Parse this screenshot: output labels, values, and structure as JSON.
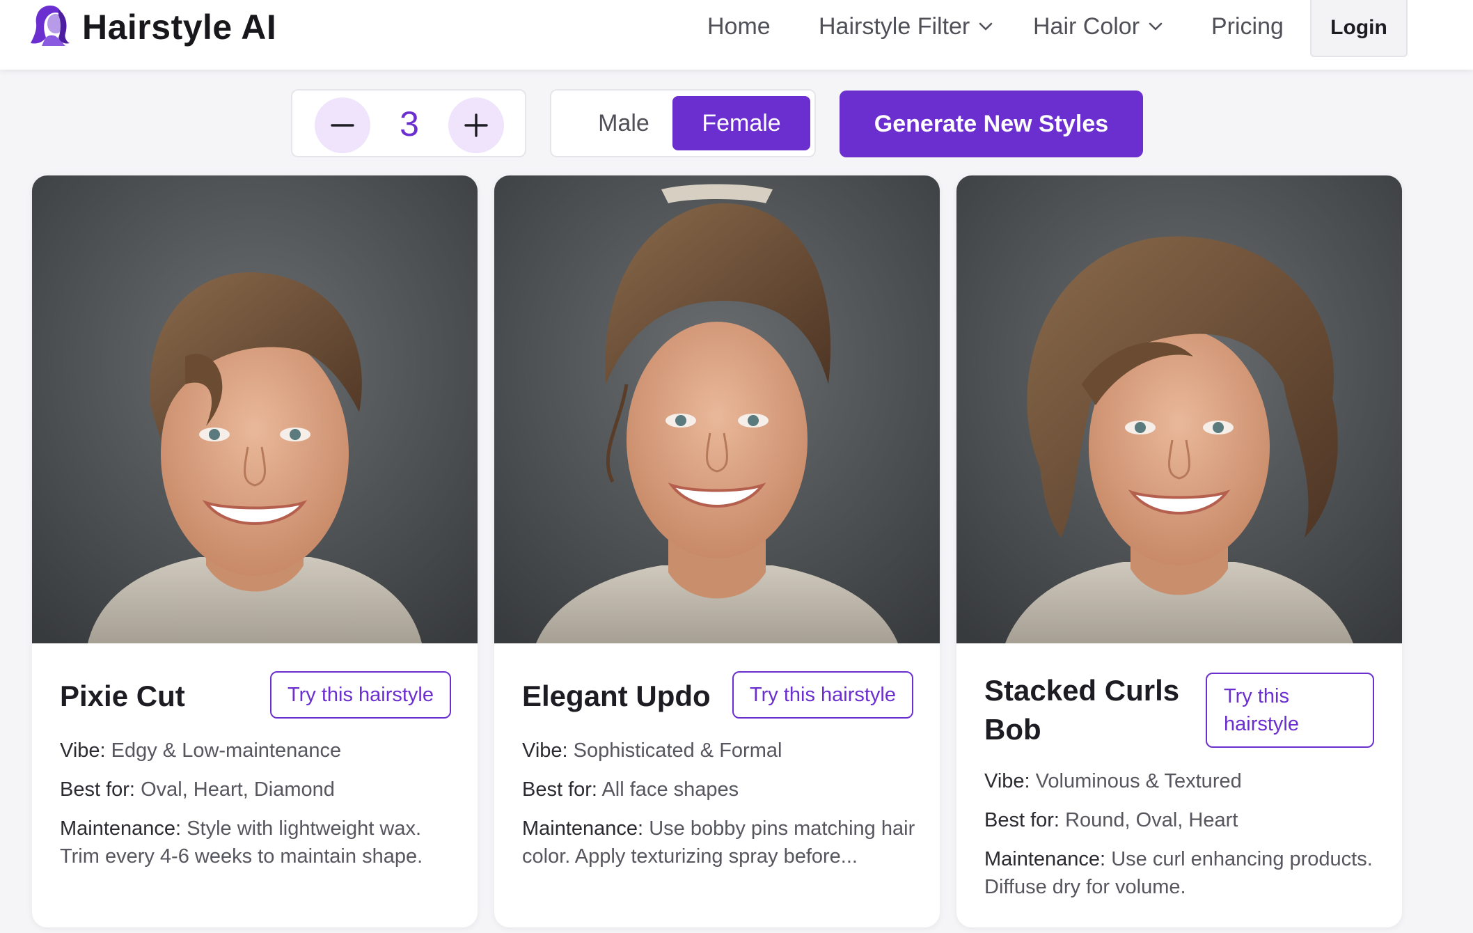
{
  "app": {
    "name": "Hairstyle AI",
    "logo_icon": "woman-silhouette-icon"
  },
  "nav": {
    "home": "Home",
    "hairstyle_filter": "Hairstyle Filter",
    "hair_color": "Hair Color",
    "pricing": "Pricing",
    "login": "Login"
  },
  "controls": {
    "count": "3",
    "decrement_icon": "minus-icon",
    "increment_icon": "plus-icon",
    "gender_options": [
      "Male",
      "Female"
    ],
    "gender_selected": "Female",
    "generate": "Generate New Styles"
  },
  "colors": {
    "accent": "#6b2fd0",
    "accent_light": "#efe4fb",
    "background": "#f5f5f8"
  },
  "cards": [
    {
      "title": "Pixie Cut",
      "cta": "Try this hairstyle",
      "vibe_label": "Vibe:",
      "vibe": "Edgy & Low-maintenance",
      "best_label": "Best for:",
      "best": "Oval, Heart, Diamond",
      "maint_label": "Maintenance:",
      "maint": "Style with lightweight wax. Trim every 4-6 weeks to maintain shape."
    },
    {
      "title": "Elegant Updo",
      "cta": "Try this hairstyle",
      "vibe_label": "Vibe:",
      "vibe": "Sophisticated & Formal",
      "best_label": "Best for:",
      "best": "All face shapes",
      "maint_label": "Maintenance:",
      "maint": "Use bobby pins matching hair color. Apply texturizing spray before..."
    },
    {
      "title": "Stacked Curls Bob",
      "cta": "Try this hairstyle",
      "vibe_label": "Vibe:",
      "vibe": "Voluminous & Textured",
      "best_label": "Best for:",
      "best": "Round, Oval, Heart",
      "maint_label": "Maintenance:",
      "maint": "Use curl enhancing products. Diffuse dry for volume."
    }
  ]
}
